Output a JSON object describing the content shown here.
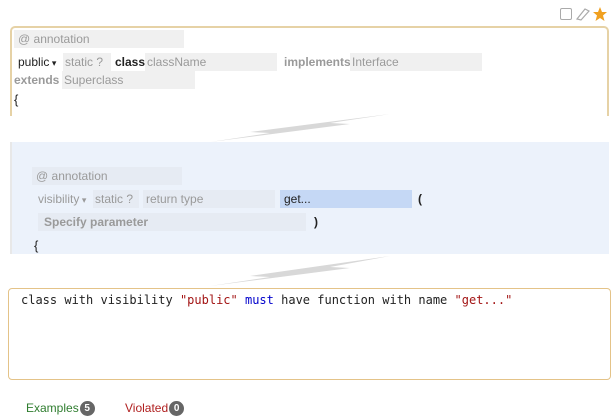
{
  "panel1": {
    "annotation_placeholder": "@ annotation",
    "visibility": "public",
    "static_toggle": "static ?",
    "class_keyword": "class",
    "classname_placeholder": "className",
    "implements_keyword": "implements",
    "interface_placeholder": "Interface",
    "extends_keyword": "extends",
    "superclass_placeholder": "Superclass",
    "open_brace": "{"
  },
  "panel2": {
    "annotation_placeholder": "@ annotation",
    "visibility_placeholder": "visibility",
    "static_toggle": "static ?",
    "return_type_placeholder": "return type",
    "function_name": "get...",
    "open_paren": "(",
    "parameter_placeholder": "Specify parameter",
    "close_paren": ")",
    "open_brace": "{"
  },
  "description": {
    "prefix": "class with visibility ",
    "visibility_value": "\"public\"",
    "must": "must",
    "middle": " have function with name ",
    "name_value": "\"get...\""
  },
  "tabs": {
    "examples_label": "Examples",
    "examples_count": "5",
    "violated_label": "Violated",
    "violated_count": "0"
  },
  "colors": {
    "panel_border": "#e6d2a6",
    "selected_bg": "#ecf2fb",
    "name_field_bg": "#c5d8f5",
    "star_active": "#f0a020",
    "star_inactive": "#b8b8b8",
    "string": "#a31515",
    "keyword": "#0000cc",
    "examples": "#2f7d2f",
    "violated": "#b02020"
  },
  "icons": [
    "checkbox-icon",
    "eraser-icon",
    "star-icon",
    "zigzag-connector-icon",
    "caret-down-icon"
  ]
}
